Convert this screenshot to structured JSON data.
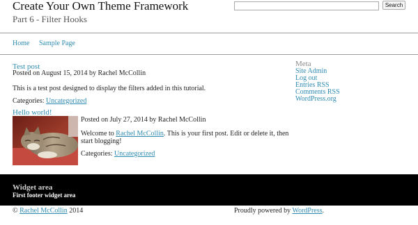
{
  "site": {
    "title": "Create Your Own Theme Framework",
    "description": "Part 6 - Filter Hooks"
  },
  "search": {
    "value": "",
    "placeholder": "",
    "button_label": "Search"
  },
  "nav": {
    "items": [
      {
        "label": "Home"
      },
      {
        "label": "Sample Page"
      }
    ]
  },
  "posts": [
    {
      "title": "Test post",
      "meta": "Posted on August 15, 2014 by Rachel McCollin",
      "body": "This is a test post designed to display the filters added in this tutorial.",
      "categories_label": "Categories:",
      "category": "Uncategorized"
    },
    {
      "title": "Hello world!",
      "meta": "Posted on July 27, 2014 by Rachel McCollin",
      "body_prefix": "Welcome to",
      "body_link": "Rachel McCollin",
      "body_suffix": ". This is your first post. Edit or delete it, then",
      "body_line2": "start blogging!",
      "categories_label": "Categories:",
      "category": "Uncategorized",
      "thumbnail": "cat-photo"
    }
  ],
  "sidebar": {
    "heading": "Meta",
    "links": [
      "Site Admin",
      "Log out",
      "Entries RSS",
      "Comments RSS",
      "WordPress.org"
    ]
  },
  "widget": {
    "title": "Widget area",
    "text": "First footer widget area"
  },
  "footer": {
    "copyright": "©",
    "author": "Rachel McCollin",
    "year": "2014",
    "powered_prefix": "Proudly powered by",
    "powered_link": "WordPress",
    "powered_suffix": "."
  },
  "colors": {
    "link": "#2d8ab1",
    "widget_bg": "#000000",
    "rule": "#9a9a9a"
  }
}
